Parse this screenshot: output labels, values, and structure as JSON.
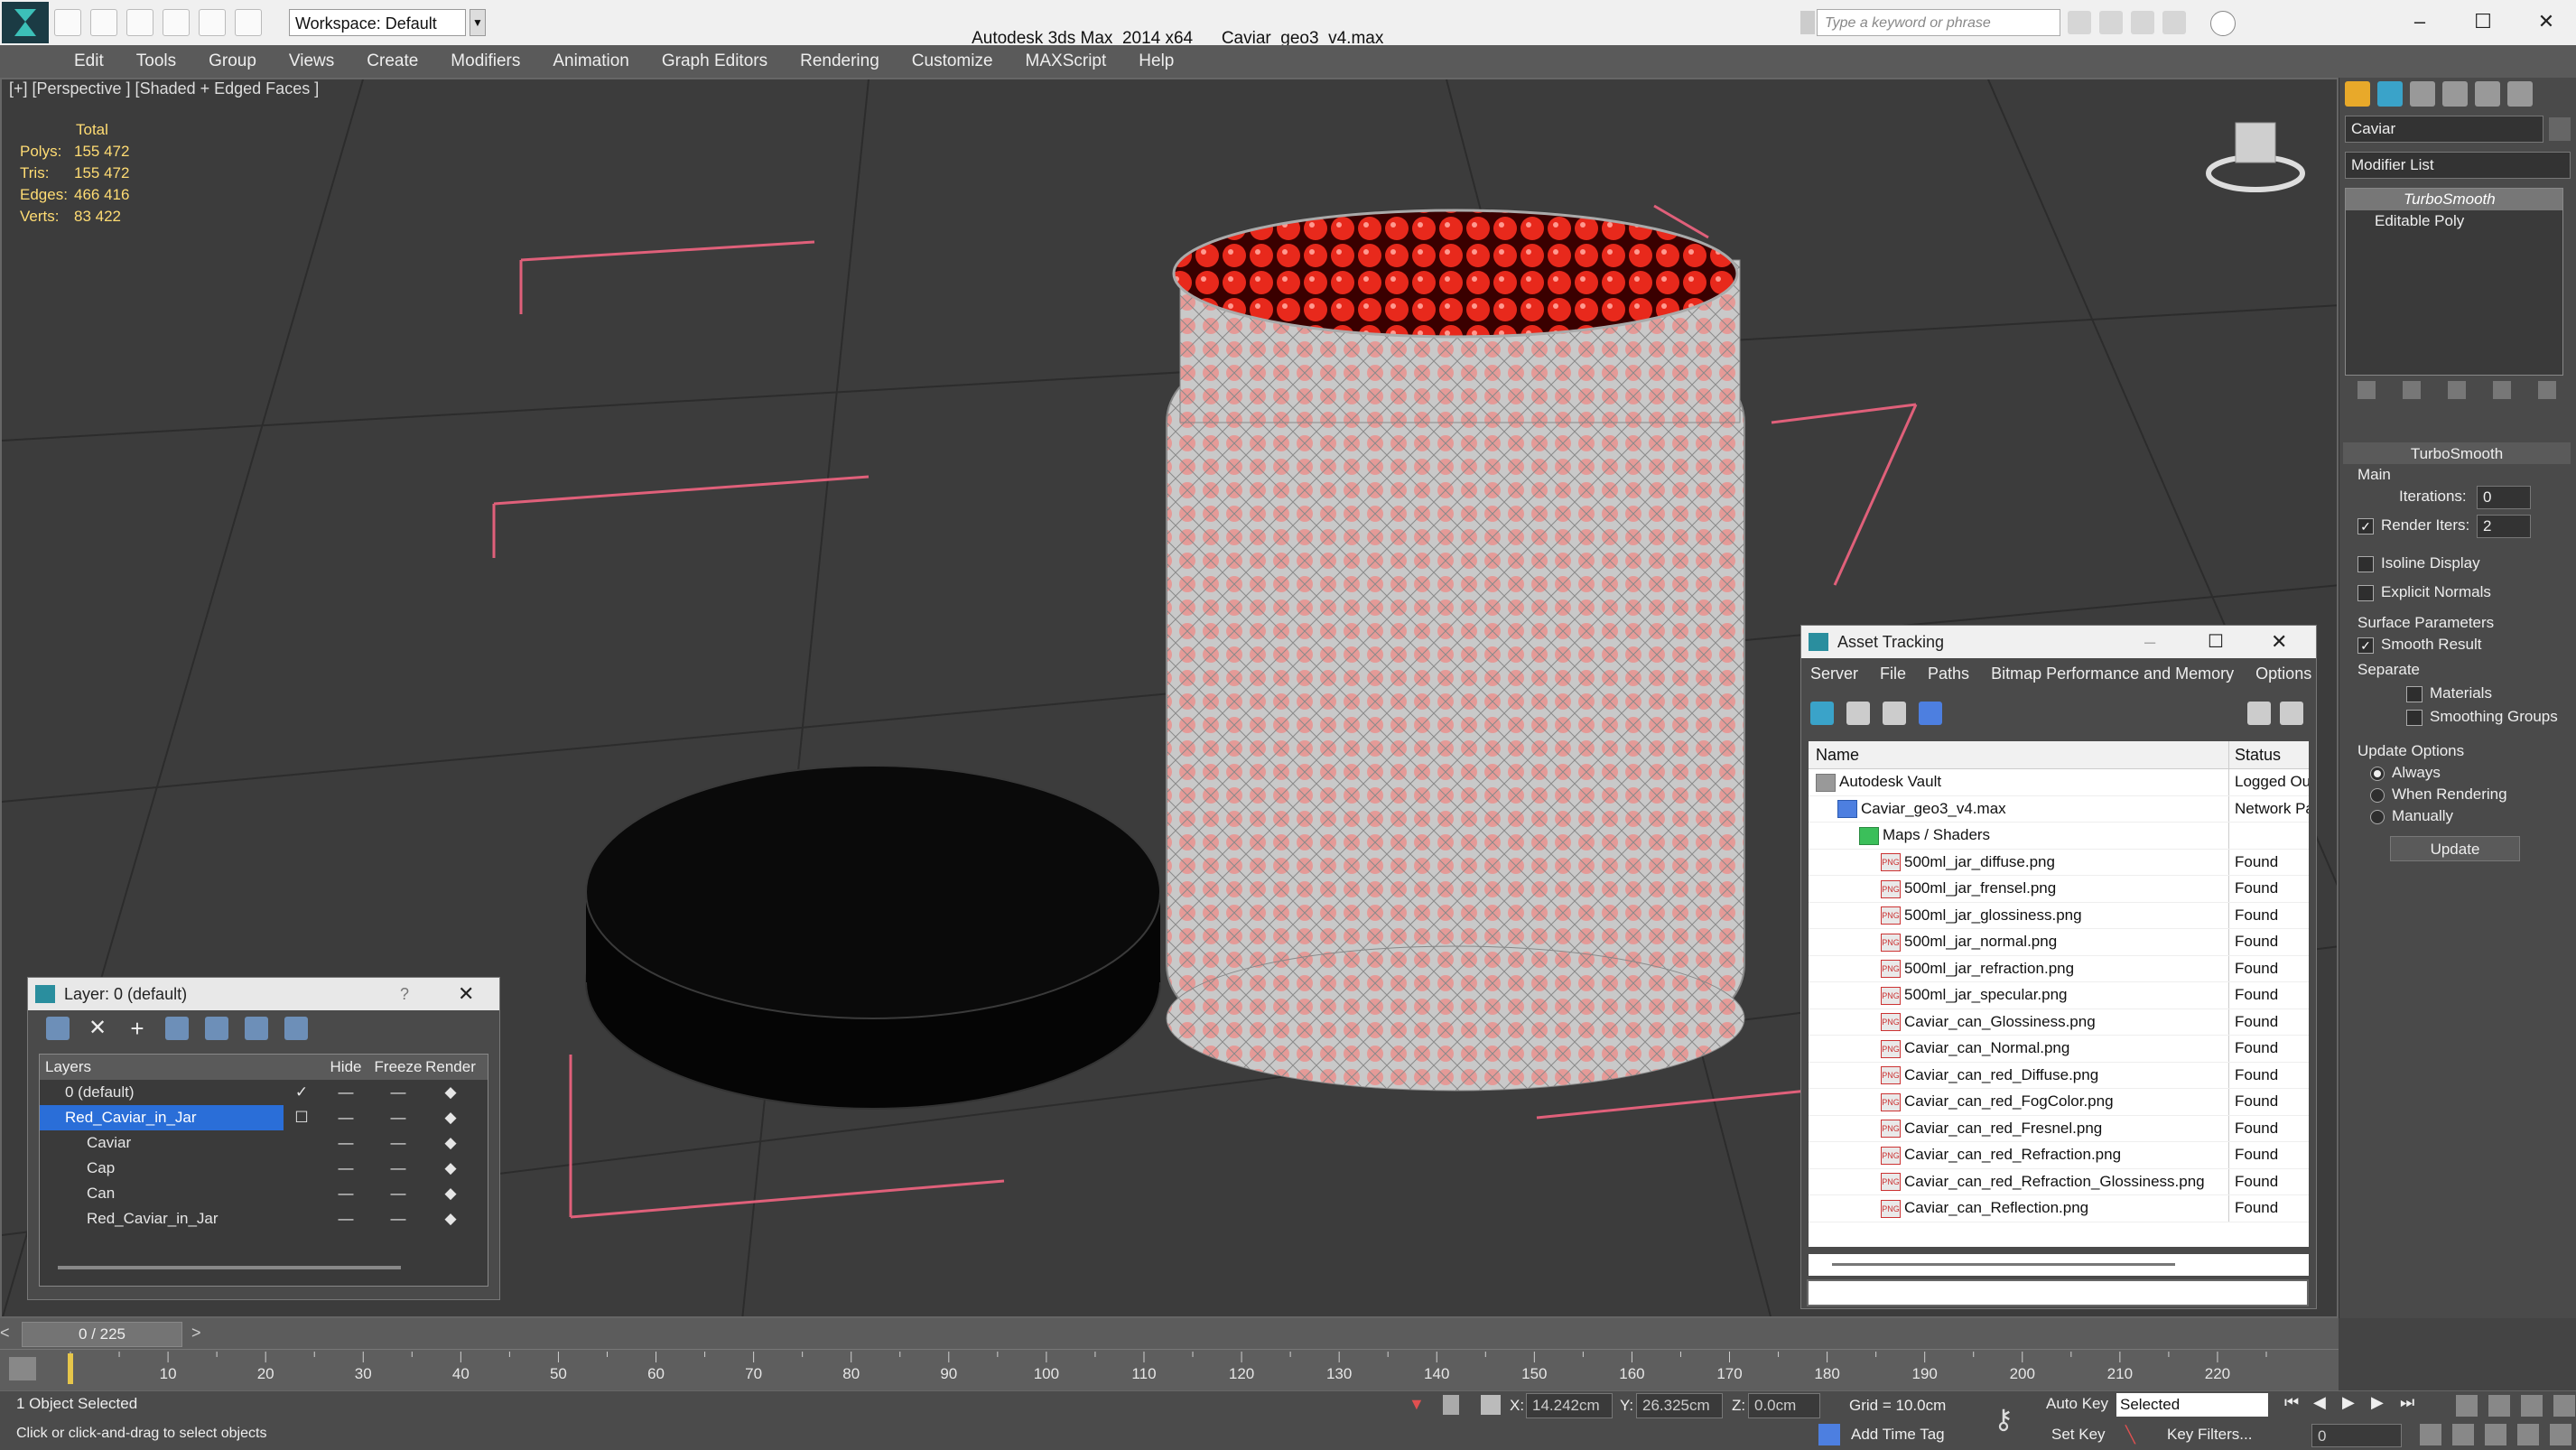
{
  "titlebar": {
    "workspace": "Workspace: Default",
    "app_name": "Autodesk 3ds Max  2014 x64",
    "file_name": "Caviar_geo3_v4.max",
    "search_placeholder": "Type a keyword or phrase"
  },
  "menu": [
    "Edit",
    "Tools",
    "Group",
    "Views",
    "Create",
    "Modifiers",
    "Animation",
    "Graph Editors",
    "Rendering",
    "Customize",
    "MAXScript",
    "Help"
  ],
  "viewport": {
    "label": "[+] [Perspective ] [Shaded + Edged Faces ]",
    "stats": {
      "header": "Total",
      "rows": [
        {
          "k": "Polys:",
          "v": "155 472"
        },
        {
          "k": "Tris:",
          "v": "155 472"
        },
        {
          "k": "Edges:",
          "v": "466 416"
        },
        {
          "k": "Verts:",
          "v": "83 422"
        }
      ]
    }
  },
  "layer_window": {
    "title": "Layer: 0 (default)",
    "help": "?",
    "columns": [
      "Layers",
      "Hide",
      "Freeze",
      "Render"
    ],
    "rows": [
      {
        "name": "0 (default)",
        "indent": 1,
        "selected": false
      },
      {
        "name": "Red_Caviar_in_Jar",
        "indent": 1,
        "selected": true
      },
      {
        "name": "Caviar",
        "indent": 2,
        "selected": false
      },
      {
        "name": "Cap",
        "indent": 2,
        "selected": false
      },
      {
        "name": "Can",
        "indent": 2,
        "selected": false
      },
      {
        "name": "Red_Caviar_in_Jar",
        "indent": 2,
        "selected": false
      }
    ]
  },
  "asset_tracking": {
    "title": "Asset Tracking",
    "menu": [
      "Server",
      "File",
      "Paths",
      "Bitmap Performance and Memory",
      "Options"
    ],
    "columns": [
      "Name",
      "Status"
    ],
    "rows": [
      {
        "name": "Autodesk Vault",
        "status": "Logged Out",
        "level": 1,
        "icon": "vault-icon"
      },
      {
        "name": "Caviar_geo3_v4.max",
        "status": "Network Path",
        "level": 2,
        "icon": "max-file-icon"
      },
      {
        "name": "Maps / Shaders",
        "status": "",
        "level": 3,
        "icon": "maps-icon"
      },
      {
        "name": "500ml_jar_diffuse.png",
        "status": "Found",
        "level": 4,
        "icon": "png-icon"
      },
      {
        "name": "500ml_jar_frensel.png",
        "status": "Found",
        "level": 4,
        "icon": "png-icon"
      },
      {
        "name": "500ml_jar_glossiness.png",
        "status": "Found",
        "level": 4,
        "icon": "png-icon"
      },
      {
        "name": "500ml_jar_normal.png",
        "status": "Found",
        "level": 4,
        "icon": "png-icon"
      },
      {
        "name": "500ml_jar_refraction.png",
        "status": "Found",
        "level": 4,
        "icon": "png-icon"
      },
      {
        "name": "500ml_jar_specular.png",
        "status": "Found",
        "level": 4,
        "icon": "png-icon"
      },
      {
        "name": "Caviar_can_Glossiness.png",
        "status": "Found",
        "level": 4,
        "icon": "png-icon"
      },
      {
        "name": "Caviar_can_Normal.png",
        "status": "Found",
        "level": 4,
        "icon": "png-icon"
      },
      {
        "name": "Caviar_can_red_Diffuse.png",
        "status": "Found",
        "level": 4,
        "icon": "png-icon"
      },
      {
        "name": "Caviar_can_red_FogColor.png",
        "status": "Found",
        "level": 4,
        "icon": "png-icon"
      },
      {
        "name": "Caviar_can_red_Fresnel.png",
        "status": "Found",
        "level": 4,
        "icon": "png-icon"
      },
      {
        "name": "Caviar_can_red_Refraction.png",
        "status": "Found",
        "level": 4,
        "icon": "png-icon"
      },
      {
        "name": "Caviar_can_red_Refraction_Glossiness.png",
        "status": "Found",
        "level": 4,
        "icon": "png-icon"
      },
      {
        "name": "Caviar_can_Reflection.png",
        "status": "Found",
        "level": 4,
        "icon": "png-icon"
      }
    ]
  },
  "command_panel": {
    "object_name": "Caviar",
    "modifier_list": "Modifier List",
    "stack": [
      "TurboSmooth",
      "Editable Poly"
    ],
    "rollout_title": "TurboSmooth",
    "main_label": "Main",
    "iterations_label": "Iterations:",
    "iterations_value": "0",
    "render_iters_label": "Render Iters:",
    "render_iters_value": "2",
    "isoline": "Isoline Display",
    "explicit_normals": "Explicit Normals",
    "surface_params": "Surface Parameters",
    "smooth_result": "Smooth Result",
    "separate": "Separate",
    "materials": "Materials",
    "smoothing_groups": "Smoothing Groups",
    "update_options": "Update Options",
    "always": "Always",
    "when_rendering": "When Rendering",
    "manually": "Manually",
    "update_button": "Update"
  },
  "timeline": {
    "frame_display": "0 / 225",
    "ticks": [
      "10",
      "20",
      "30",
      "40",
      "50",
      "60",
      "70",
      "80",
      "90",
      "100",
      "110",
      "120",
      "130",
      "140",
      "150",
      "160",
      "170",
      "180",
      "190",
      "200",
      "210",
      "220"
    ],
    "tick_values": [
      10,
      20,
      30,
      40,
      50,
      60,
      70,
      80,
      90,
      100,
      110,
      120,
      130,
      140,
      150,
      160,
      170,
      180,
      190,
      200,
      210,
      220
    ],
    "max_frame": 225
  },
  "status": {
    "selection": "1 Object Selected",
    "prompt": "Click or click-and-drag to select objects",
    "x_label": "X:",
    "x_value": "14.242cm",
    "y_label": "Y:",
    "y_value": "26.325cm",
    "z_label": "Z:",
    "z_value": "0.0cm",
    "grid": "Grid = 10.0cm",
    "add_time_tag": "Add Time Tag",
    "auto_key": "Auto Key",
    "set_key": "Set Key",
    "key_mode": "Selected",
    "key_filters": "Key Filters...",
    "frame_field": "0"
  },
  "colors": {
    "accent": "#2a6ed8",
    "stats_yellow": "#ffdc73",
    "bbox_pink": "#e0607a",
    "caviar_red": "#e8291c"
  }
}
